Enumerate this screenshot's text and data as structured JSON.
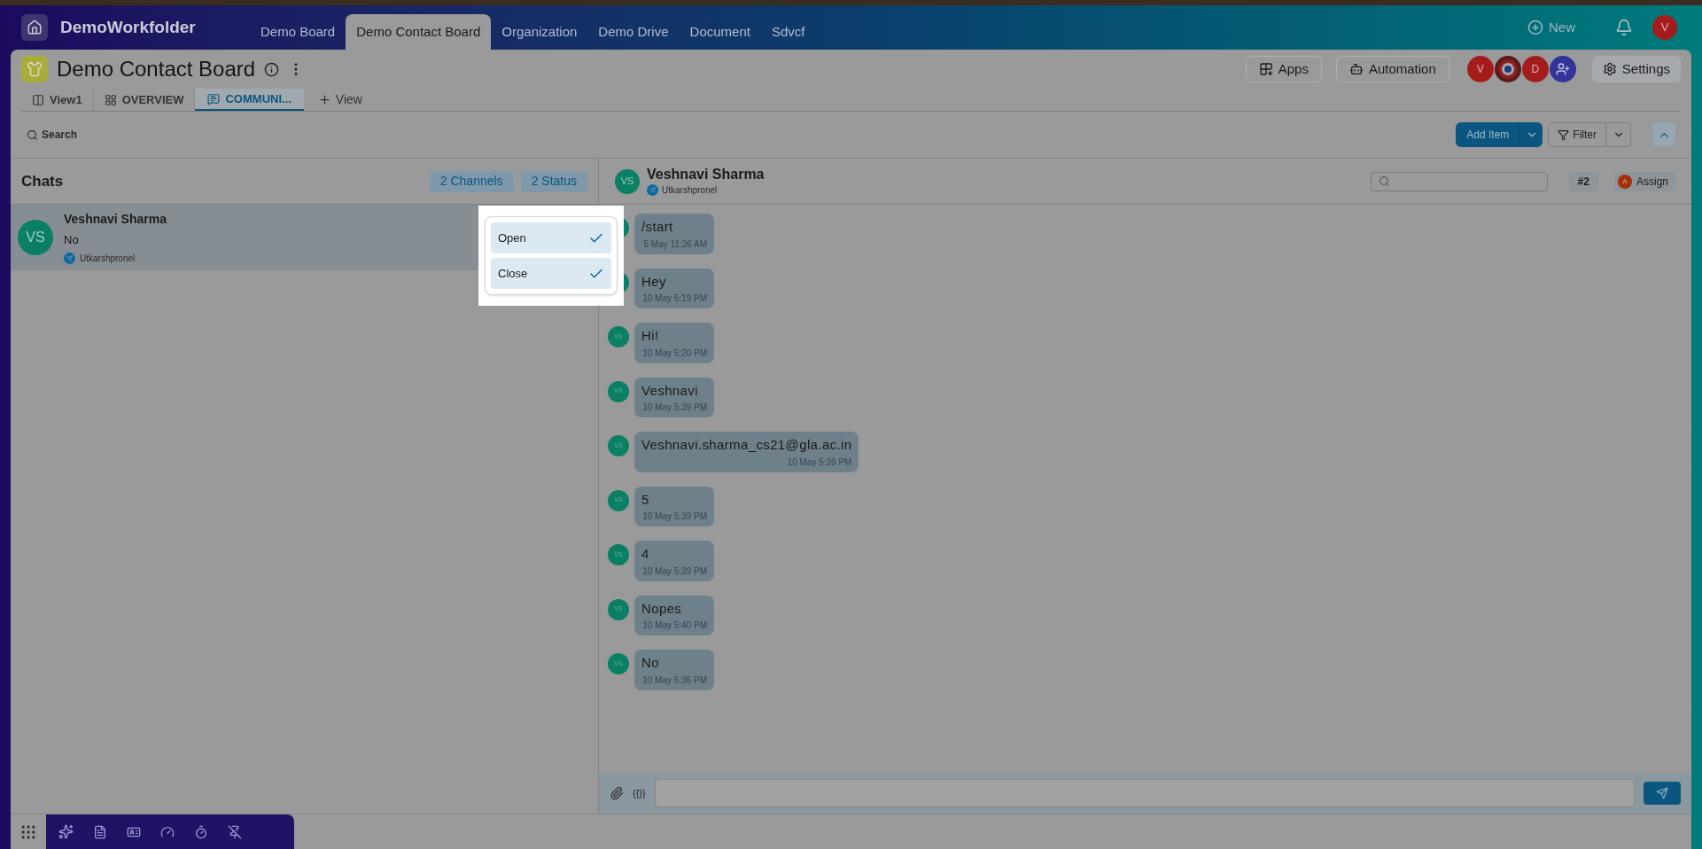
{
  "app": {
    "name": "DemoWorkfolder"
  },
  "top_tabs": [
    {
      "label": "Demo Board",
      "selected": false
    },
    {
      "label": "Demo Contact Board",
      "selected": true
    },
    {
      "label": "Organization",
      "selected": false
    },
    {
      "label": "Demo Drive",
      "selected": false
    },
    {
      "label": "Document",
      "selected": false
    },
    {
      "label": "Sdvcf",
      "selected": false
    }
  ],
  "top_actions": {
    "new": "New",
    "user_initial": "V"
  },
  "board": {
    "title": "Demo Contact Board",
    "views": [
      {
        "label": "View1",
        "kind": "kanban",
        "selected": false
      },
      {
        "label": "OVERVIEW",
        "kind": "grid",
        "selected": false
      },
      {
        "label": "COMMUNI...",
        "kind": "chat",
        "selected": true
      }
    ],
    "add_view": "View",
    "apps": "Apps",
    "automation": "Automation",
    "members": [
      {
        "kind": "initial",
        "text": "V"
      },
      {
        "kind": "picture"
      },
      {
        "kind": "initial",
        "text": "D"
      },
      {
        "kind": "add"
      }
    ],
    "settings": "Settings"
  },
  "toolbar": {
    "search": "Search",
    "add_item": "Add Item",
    "filter": "Filter"
  },
  "chats": {
    "title": "Chats",
    "channels_filter": "2 Channels",
    "status_filter": "2 Status",
    "items": [
      {
        "initials": "VS",
        "name": "Veshnavi Sharma",
        "preview": "No",
        "channel": "Utkarshpronel",
        "selected": true
      }
    ]
  },
  "status_menu": {
    "options": [
      {
        "label": "Open",
        "checked": true
      },
      {
        "label": "Close",
        "checked": true
      }
    ]
  },
  "conversation": {
    "initials": "VS",
    "name": "Veshnavi Sharma",
    "channel": "Utkarshpronel",
    "ticket": "#2",
    "assignee_initial": "A",
    "assign": "Assign",
    "messages": [
      {
        "text": "/start",
        "time": "5 May 11:36 AM"
      },
      {
        "text": "Hey",
        "time": "10 May 5:19 PM"
      },
      {
        "initials": "VS",
        "text": "Hi!",
        "time": "10 May 5:20 PM"
      },
      {
        "initials": "VS",
        "text": "Veshnavi",
        "time": "10 May 5:39 PM"
      },
      {
        "initials": "VS",
        "text": "Veshnavi.sharma_cs21@gla.ac.in",
        "time": "10 May 5:39 PM"
      },
      {
        "initials": "VS",
        "text": "5",
        "time": "10 May 5:39 PM"
      },
      {
        "initials": "VS",
        "text": "4",
        "time": "10 May 5:39 PM"
      },
      {
        "initials": "VS",
        "text": "Nopes",
        "time": "10 May 5:40 PM"
      },
      {
        "initials": "VS",
        "text": "No",
        "time": "10 May 6:36 PM"
      }
    ],
    "variables": "{{}}"
  }
}
